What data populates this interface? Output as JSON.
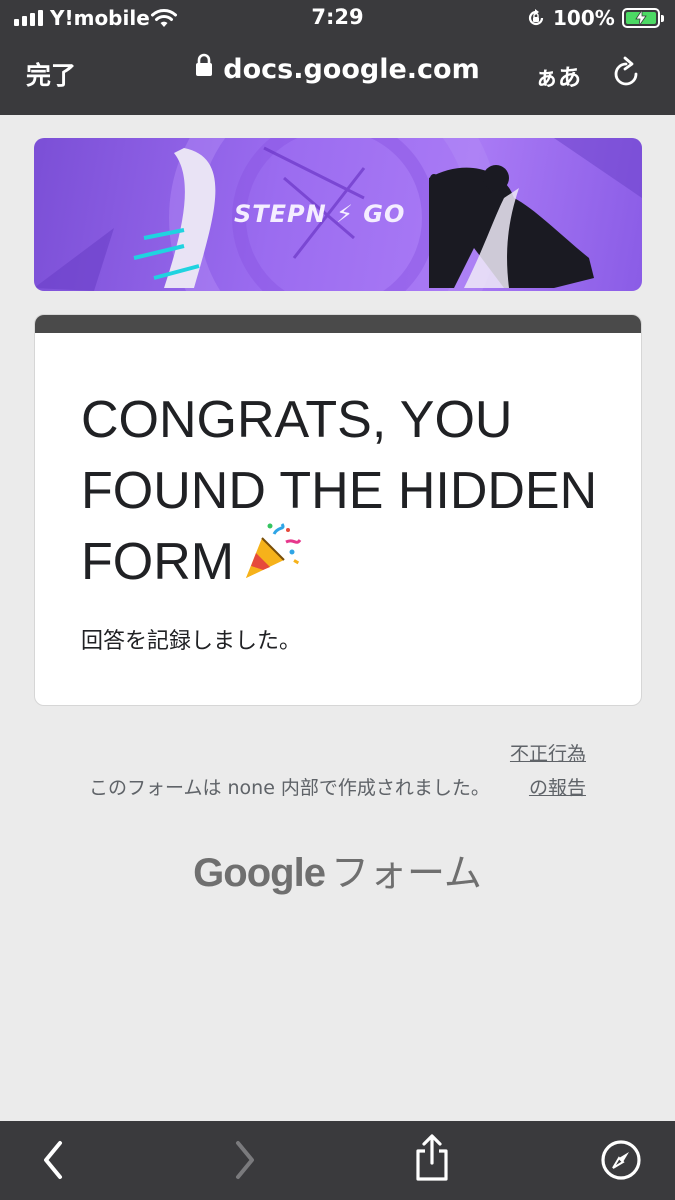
{
  "status_bar": {
    "carrier": "Y!mobile",
    "time": "7:29",
    "battery": "100%"
  },
  "browser": {
    "done_label": "完了",
    "url": "docs.google.com",
    "text_size_label": "ぁあ"
  },
  "icons": {
    "signal": "signal-icon",
    "wifi": "wifi-icon",
    "orientation_lock": "orientation-lock-icon",
    "battery": "battery-charging-icon",
    "padlock": "lock-icon",
    "reload": "reload-icon",
    "back": "chevron-left-icon",
    "forward": "chevron-right-icon",
    "share": "share-icon",
    "safari": "compass-icon",
    "party": "party-popper-icon"
  },
  "banner": {
    "logo_text": "STEPN ⚡ GO"
  },
  "form": {
    "title": "CONGRATS, YOU FOUND THE HIDDEN FORM",
    "confirmation": "回答を記録しました。"
  },
  "footer": {
    "note": "このフォームは none 内部で作成されました。",
    "report_link": "不正行為の報告"
  },
  "branding": {
    "google": "Google",
    "forms": "フォーム"
  },
  "colors": {
    "chrome": "#3a3a3d",
    "banner_purple": "#9b6cf0",
    "card_header": "#4a4a4a",
    "battery_green": "#4cd964"
  }
}
